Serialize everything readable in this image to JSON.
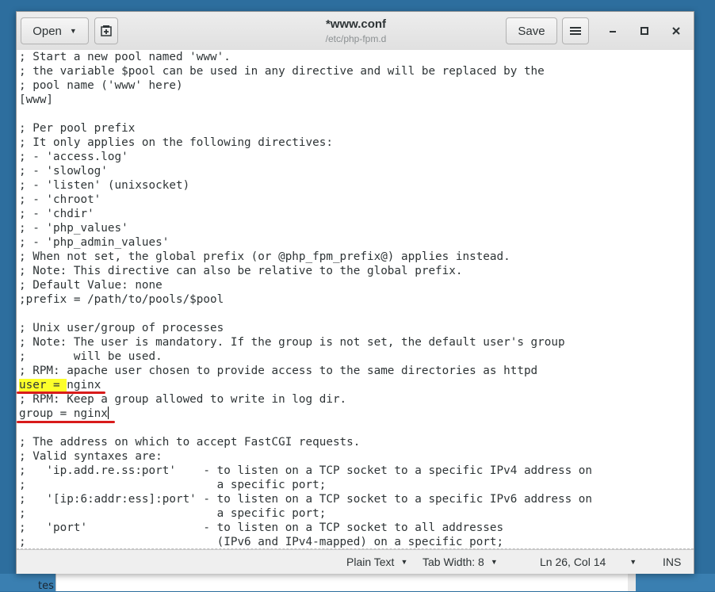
{
  "window": {
    "title": "*www.conf",
    "subtitle": "/etc/php-fpm.d",
    "open_label": "Open",
    "save_label": "Save"
  },
  "editor": {
    "lines": [
      "; Start a new pool named 'www'.",
      "; the variable $pool can be used in any directive and will be replaced by the",
      "; pool name ('www' here)",
      "[www]",
      "",
      "; Per pool prefix",
      "; It only applies on the following directives:",
      "; - 'access.log'",
      "; - 'slowlog'",
      "; - 'listen' (unixsocket)",
      "; - 'chroot'",
      "; - 'chdir'",
      "; - 'php_values'",
      "; - 'php_admin_values'",
      "; When not set, the global prefix (or @php_fpm_prefix@) applies instead.",
      "; Note: This directive can also be relative to the global prefix.",
      "; Default Value: none",
      ";prefix = /path/to/pools/$pool",
      "",
      "; Unix user/group of processes",
      "; Note: The user is mandatory. If the group is not set, the default user's group",
      ";       will be used.",
      "; RPM: apache user chosen to provide access to the same directories as httpd",
      "user = nginx",
      "; RPM: Keep a group allowed to write in log dir.",
      "group = nginx",
      "",
      "; The address on which to accept FastCGI requests.",
      "; Valid syntaxes are:",
      ";   'ip.add.re.ss:port'    - to listen on a TCP socket to a specific IPv4 address on",
      ";                            a specific port;",
      ";   '[ip:6:addr:ess]:port' - to listen on a TCP socket to a specific IPv6 address on",
      ";                            a specific port;",
      ";   'port'                 - to listen on a TCP socket to all addresses",
      ";                            (IPv6 and IPv4-mapped) on a specific port;"
    ],
    "highlighted_text": "user = ",
    "highlighted_rest": "nginx"
  },
  "statusbar": {
    "language": "Plain Text",
    "tab_width": "Tab Width: 8",
    "position": "Ln 26, Col 14",
    "mode": "INS"
  },
  "desktop": {
    "partial_text": "tes"
  },
  "icons": [
    "new-tab-icon",
    "hamburger-menu-icon",
    "minimize-icon",
    "maximize-icon",
    "close-icon",
    "chevron-down-icon"
  ]
}
